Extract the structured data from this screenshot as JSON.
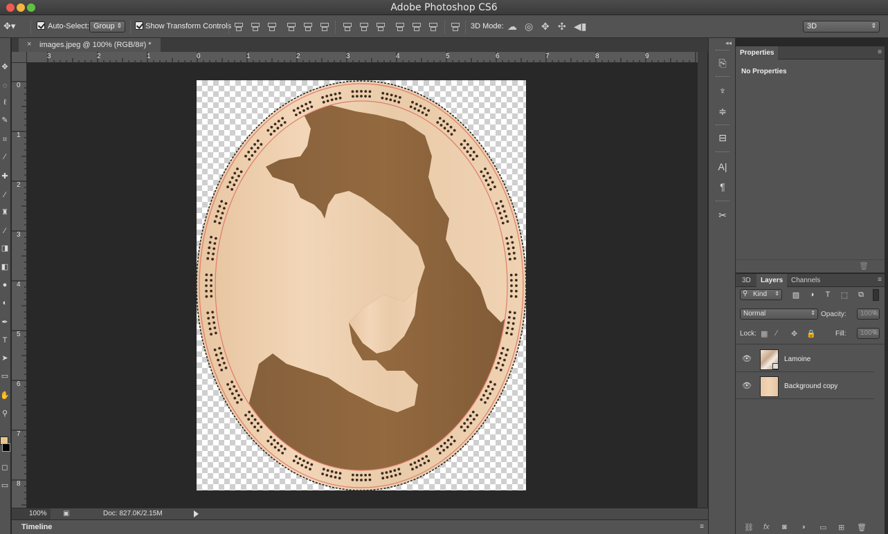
{
  "window": {
    "title": "Adobe Photoshop CS6"
  },
  "options_bar": {
    "auto_select_label": "Auto-Select:",
    "auto_select_checked": true,
    "auto_select_mode": "Group",
    "show_transform_label": "Show Transform Controls",
    "show_transform_checked": true,
    "three_d_mode_label": "3D Mode:",
    "workspace": "3D"
  },
  "document": {
    "tab_title": "images.jpeg @ 100% (RGB/8#) *",
    "close_glyph": "×"
  },
  "rulers": {
    "horizontal": [
      "3",
      "2",
      "1",
      "0",
      "1",
      "2",
      "3",
      "4",
      "5",
      "6",
      "7",
      "8",
      "9"
    ],
    "vertical": [
      "0",
      "1",
      "2",
      "3",
      "4",
      "5",
      "6",
      "7",
      "8"
    ]
  },
  "status_bar": {
    "zoom": "100%",
    "doc_info": "Doc: 827.0K/2.15M"
  },
  "timeline": {
    "label": "Timeline"
  },
  "properties_panel": {
    "tab": "Properties",
    "message": "No Properties"
  },
  "layers_panel": {
    "tabs": [
      "3D",
      "Layers",
      "Channels"
    ],
    "active_tab": "Layers",
    "filter_kind": "Kind",
    "blend_mode": "Normal",
    "opacity_label": "Opacity:",
    "opacity_value": "100%",
    "lock_label": "Lock:",
    "fill_label": "Fill:",
    "fill_value": "100%",
    "layers": [
      {
        "name": "Lamoine",
        "visible": true
      },
      {
        "name": "Background copy",
        "visible": true
      }
    ]
  },
  "colors": {
    "foreground": "#e8c88a",
    "background": "#000000",
    "wood_light": "#edcfae",
    "wood_dark": "#8c6640",
    "rim_line": "#e07a6a"
  }
}
